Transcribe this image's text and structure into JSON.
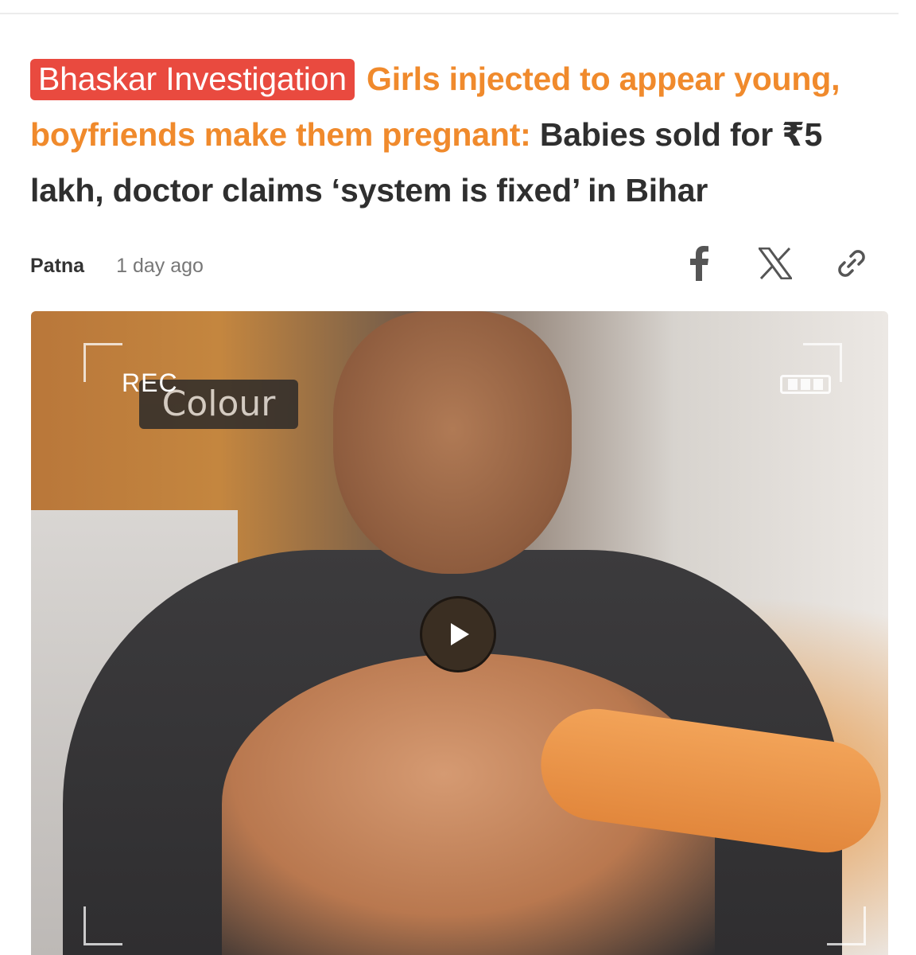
{
  "article": {
    "tag": "Bhaskar Investigation",
    "headline_highlight": "Girls injected to appear young, boyfriends make them pregnant:",
    "headline_rest": "Babies sold for ₹5 lakh, doctor claims ‘system is fixed’ in Bihar",
    "location": "Patna",
    "time": "1 day ago",
    "tag_color": "#e94a3f",
    "highlight_color": "#f08a2c"
  },
  "share": {
    "icons": [
      "facebook-icon",
      "x-icon",
      "link-icon"
    ]
  },
  "video": {
    "rec_label": "REC",
    "sign_text": "Colour",
    "play_icon": "play-icon"
  }
}
